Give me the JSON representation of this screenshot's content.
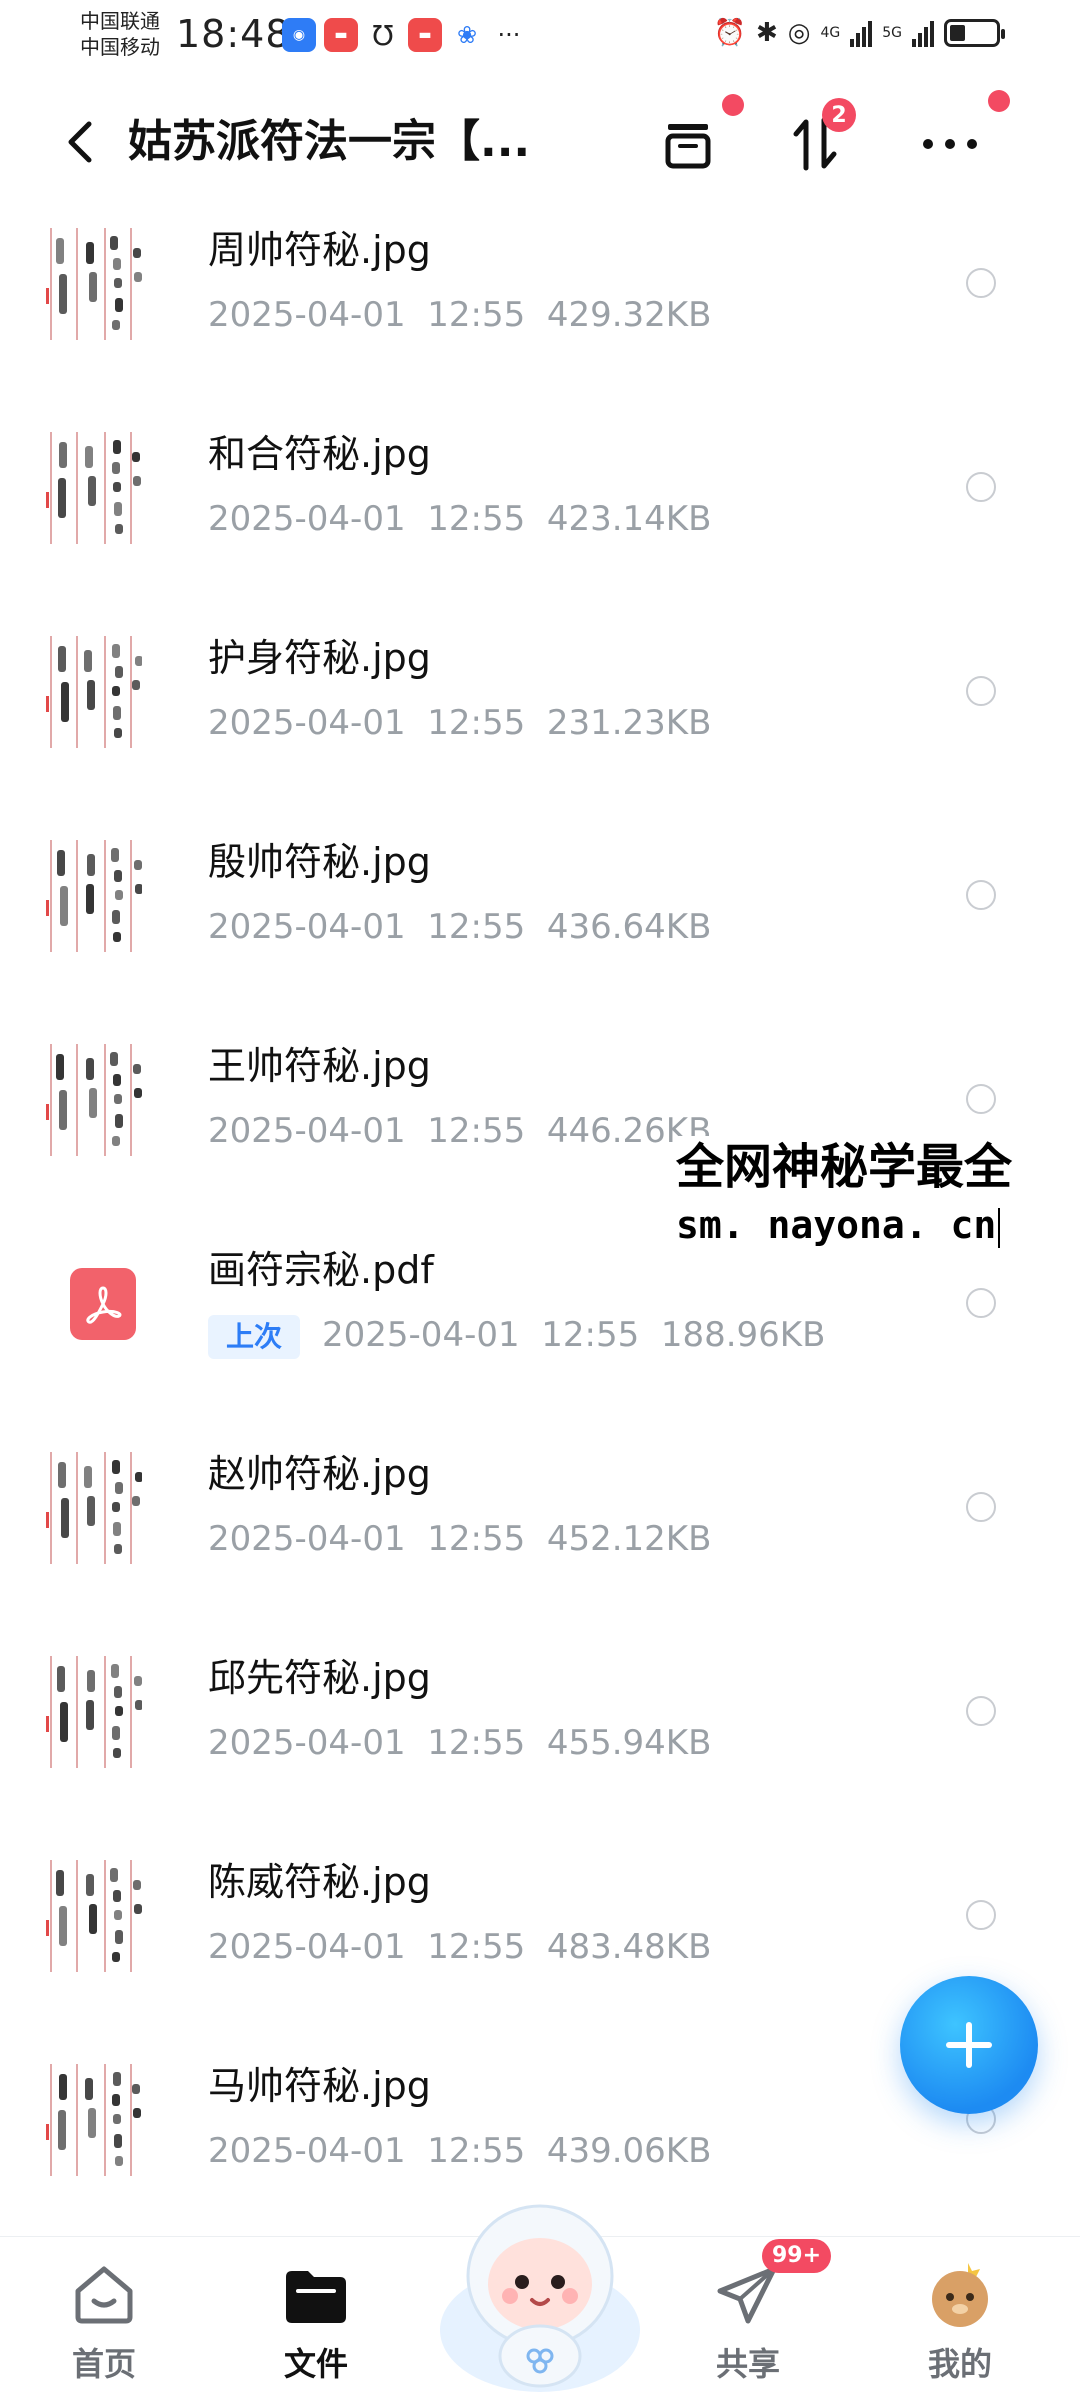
{
  "status_bar": {
    "carrier1": "中国联通",
    "carrier2": "中国移动",
    "time": "18:48",
    "net1": "4G",
    "net2": "5G",
    "battery_level": 0.35
  },
  "header": {
    "title": "姑苏派符法一宗【...",
    "transfer_badge": "2"
  },
  "files": [
    {
      "name": "周帅符秘.jpg",
      "date": "2025-04-01",
      "time": "12:55",
      "size": "429.32KB",
      "type": "image"
    },
    {
      "name": "和合符秘.jpg",
      "date": "2025-04-01",
      "time": "12:55",
      "size": "423.14KB",
      "type": "image"
    },
    {
      "name": "护身符秘.jpg",
      "date": "2025-04-01",
      "time": "12:55",
      "size": "231.23KB",
      "type": "image"
    },
    {
      "name": "殷帅符秘.jpg",
      "date": "2025-04-01",
      "time": "12:55",
      "size": "436.64KB",
      "type": "image"
    },
    {
      "name": "王帅符秘.jpg",
      "date": "2025-04-01",
      "time": "12:55",
      "size": "446.26KB",
      "type": "image"
    },
    {
      "name": "画符宗秘.pdf",
      "tag": "上次",
      "date": "2025-04-01",
      "time": "12:55",
      "size": "188.96KB",
      "type": "pdf"
    },
    {
      "name": "赵帅符秘.jpg",
      "date": "2025-04-01",
      "time": "12:55",
      "size": "452.12KB",
      "type": "image"
    },
    {
      "name": "邱先符秘.jpg",
      "date": "2025-04-01",
      "time": "12:55",
      "size": "455.94KB",
      "type": "image"
    },
    {
      "name": "陈威符秘.jpg",
      "date": "2025-04-01",
      "time": "12:55",
      "size": "483.48KB",
      "type": "image"
    },
    {
      "name": "马帅符秘.jpg",
      "date": "2025-04-01",
      "time": "12:55",
      "size": "439.06KB",
      "type": "image"
    }
  ],
  "watermark": {
    "line1": "全网神秘学最全",
    "line2": "sm. nayona. cn"
  },
  "bottom_nav": {
    "home": "首页",
    "files": "文件",
    "share": "共享",
    "share_badge": "99+",
    "me": "我的"
  },
  "colors": {
    "accent_blue": "#1d8bf2",
    "badge_red": "#f34a62",
    "pdf_red": "#f2626b",
    "meta_gray": "#9aa0a6"
  },
  "icons": {
    "back": "chevron-left-icon",
    "archive": "archive-box-icon",
    "sort": "sort-arrows-icon",
    "more": "more-dots-icon",
    "add": "plus-icon"
  }
}
